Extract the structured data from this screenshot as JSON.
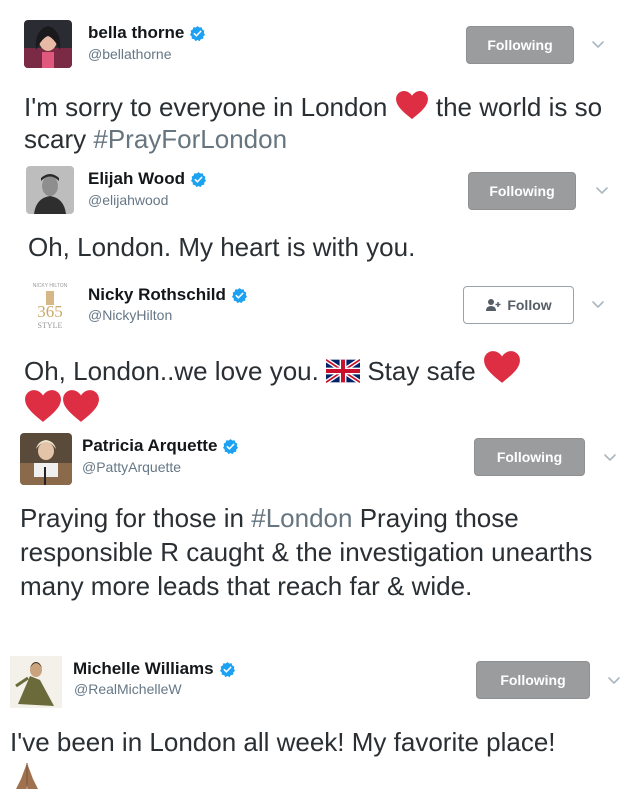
{
  "tweets": [
    {
      "name": "bella thorne",
      "handle": "@bellathorne",
      "button_label": "Following",
      "text_part1": "I'm sorry to everyone in London",
      "text_part2": "the world is so scary",
      "hashtag": "#PrayForLondon"
    },
    {
      "name": "Elijah Wood",
      "handle": "@elijahwood",
      "button_label": "Following",
      "text": "Oh, London. My heart is with you."
    },
    {
      "name": "Nicky Rothschild",
      "handle": "@NickyHilton",
      "button_label": "Follow",
      "text_part1": "Oh, London..we love you.",
      "text_part2": "Stay safe",
      "avatar_text_top": "NICKY HILTON",
      "avatar_text_num": "365",
      "avatar_text_bottom": "STYLE"
    },
    {
      "name": "Patricia Arquette",
      "handle": "@PattyArquette",
      "button_label": "Following",
      "text_part1": "Praying for those in",
      "hashtag": "#London",
      "text_part2": "Praying those responsible R caught & the investigation unearths many more leads that reach far & wide."
    },
    {
      "name": "Michelle Williams",
      "handle": "@RealMichelleW",
      "button_label": "Following",
      "text": "I've been in London all week! My favorite place!"
    }
  ],
  "colors": {
    "heart": "#dd2e44",
    "verified": "#1da1f2",
    "following_bg": "#9b9c9e",
    "hashtag": "#66757f"
  },
  "icons": [
    "verified-badge-icon",
    "chevron-down-icon",
    "heart-icon",
    "uk-flag-icon",
    "praying-hands-icon",
    "add-user-icon"
  ]
}
